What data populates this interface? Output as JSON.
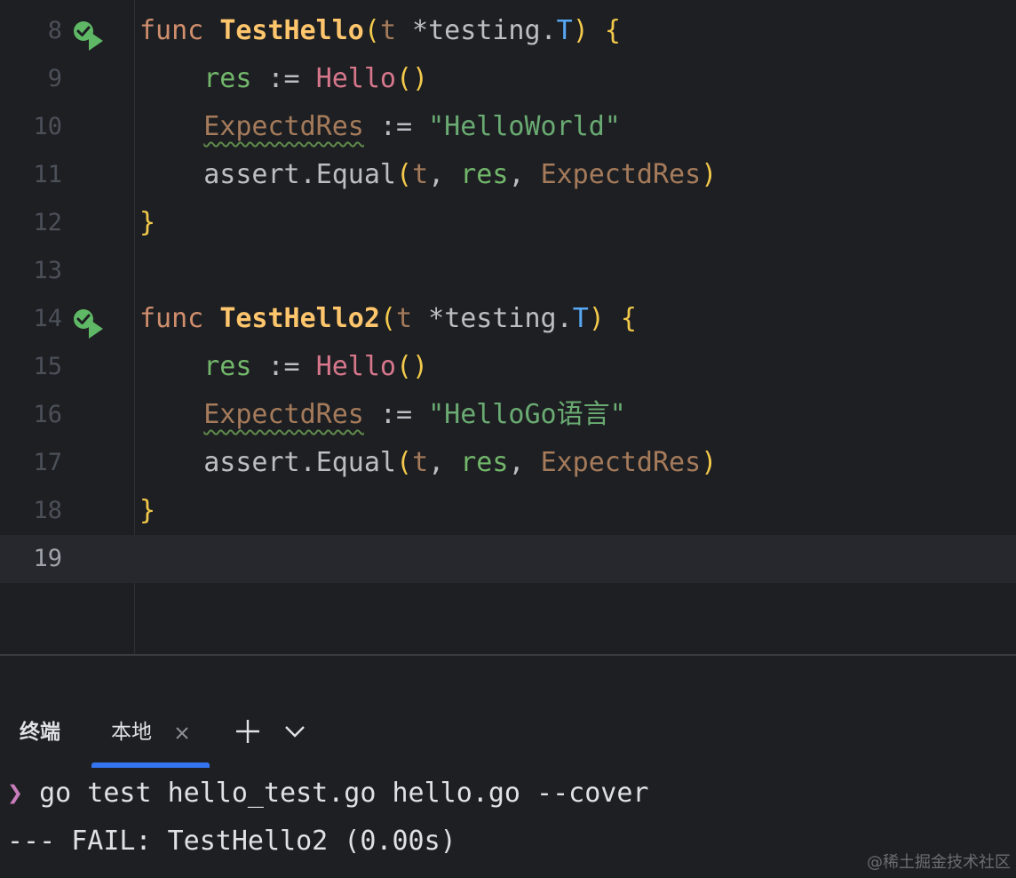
{
  "editor": {
    "lines": [
      {
        "number": "8",
        "run": true,
        "tokens": [
          {
            "t": "func",
            "c": "kw"
          },
          {
            "t": " ",
            "c": "op"
          },
          {
            "t": "TestHello",
            "c": "fnd"
          },
          {
            "t": "(",
            "c": "br1"
          },
          {
            "t": "t",
            "c": "loc"
          },
          {
            "t": " *",
            "c": "op"
          },
          {
            "t": "testing",
            "c": "punc"
          },
          {
            "t": ".",
            "c": "op"
          },
          {
            "t": "T",
            "c": "typ"
          },
          {
            "t": ")",
            "c": "br1"
          },
          {
            "t": " ",
            "c": "op"
          },
          {
            "t": "{",
            "c": "br1"
          }
        ]
      },
      {
        "number": "9",
        "run": false,
        "tokens": [
          {
            "t": "    ",
            "c": "op"
          },
          {
            "t": "res",
            "c": "var"
          },
          {
            "t": " := ",
            "c": "op"
          },
          {
            "t": "Hello",
            "c": "call"
          },
          {
            "t": "()",
            "c": "br1"
          }
        ]
      },
      {
        "number": "10",
        "run": false,
        "tokens": [
          {
            "t": "    ",
            "c": "op"
          },
          {
            "t": "ExpectdRes",
            "c": "loc",
            "w": true
          },
          {
            "t": " := ",
            "c": "op"
          },
          {
            "t": "\"HelloWorld\"",
            "c": "str"
          }
        ]
      },
      {
        "number": "11",
        "run": false,
        "tokens": [
          {
            "t": "    ",
            "c": "op"
          },
          {
            "t": "assert",
            "c": "punc"
          },
          {
            "t": ".",
            "c": "op"
          },
          {
            "t": "Equal",
            "c": "punc"
          },
          {
            "t": "(",
            "c": "br1"
          },
          {
            "t": "t",
            "c": "loc"
          },
          {
            "t": ", ",
            "c": "op"
          },
          {
            "t": "res",
            "c": "var"
          },
          {
            "t": ", ",
            "c": "op"
          },
          {
            "t": "ExpectdRes",
            "c": "loc"
          },
          {
            "t": ")",
            "c": "br1"
          }
        ]
      },
      {
        "number": "12",
        "run": false,
        "tokens": [
          {
            "t": "}",
            "c": "br1"
          }
        ]
      },
      {
        "number": "13",
        "run": false,
        "tokens": []
      },
      {
        "number": "14",
        "run": true,
        "tokens": [
          {
            "t": "func",
            "c": "kw"
          },
          {
            "t": " ",
            "c": "op"
          },
          {
            "t": "TestHello2",
            "c": "fnd"
          },
          {
            "t": "(",
            "c": "br1"
          },
          {
            "t": "t",
            "c": "loc"
          },
          {
            "t": " *",
            "c": "op"
          },
          {
            "t": "testing",
            "c": "punc"
          },
          {
            "t": ".",
            "c": "op"
          },
          {
            "t": "T",
            "c": "typ"
          },
          {
            "t": ")",
            "c": "br1"
          },
          {
            "t": " ",
            "c": "op"
          },
          {
            "t": "{",
            "c": "br1"
          }
        ]
      },
      {
        "number": "15",
        "run": false,
        "tokens": [
          {
            "t": "    ",
            "c": "op"
          },
          {
            "t": "res",
            "c": "var"
          },
          {
            "t": " := ",
            "c": "op"
          },
          {
            "t": "Hello",
            "c": "call"
          },
          {
            "t": "()",
            "c": "br1"
          }
        ]
      },
      {
        "number": "16",
        "run": false,
        "tokens": [
          {
            "t": "    ",
            "c": "op"
          },
          {
            "t": "ExpectdRes",
            "c": "loc",
            "w": true
          },
          {
            "t": " := ",
            "c": "op"
          },
          {
            "t": "\"HelloGo语言\"",
            "c": "str"
          }
        ]
      },
      {
        "number": "17",
        "run": false,
        "tokens": [
          {
            "t": "    ",
            "c": "op"
          },
          {
            "t": "assert",
            "c": "punc"
          },
          {
            "t": ".",
            "c": "op"
          },
          {
            "t": "Equal",
            "c": "punc"
          },
          {
            "t": "(",
            "c": "br1"
          },
          {
            "t": "t",
            "c": "loc"
          },
          {
            "t": ", ",
            "c": "op"
          },
          {
            "t": "res",
            "c": "var"
          },
          {
            "t": ", ",
            "c": "op"
          },
          {
            "t": "ExpectdRes",
            "c": "loc"
          },
          {
            "t": ")",
            "c": "br1"
          }
        ]
      },
      {
        "number": "18",
        "run": false,
        "tokens": [
          {
            "t": "}",
            "c": "br1"
          }
        ]
      },
      {
        "number": "19",
        "run": false,
        "current": true,
        "tokens": []
      }
    ],
    "run_icon": "run-test-passed-icon"
  },
  "terminal": {
    "title": "终端",
    "tab_label": "本地",
    "close_icon": "close-icon",
    "add_icon": "plus-icon",
    "dropdown_icon": "chevron-down-icon",
    "prompt_symbol": "❯",
    "command": " go test hello_test.go hello.go --cover",
    "output": "--- FAIL: TestHello2 (0.00s)"
  },
  "watermark": "@稀土掘金技术社区",
  "colors": {
    "background": "#1e1f22",
    "accent": "#3574f0",
    "run_icon_check": "#5fb865",
    "prompt": "#c77dbb"
  }
}
